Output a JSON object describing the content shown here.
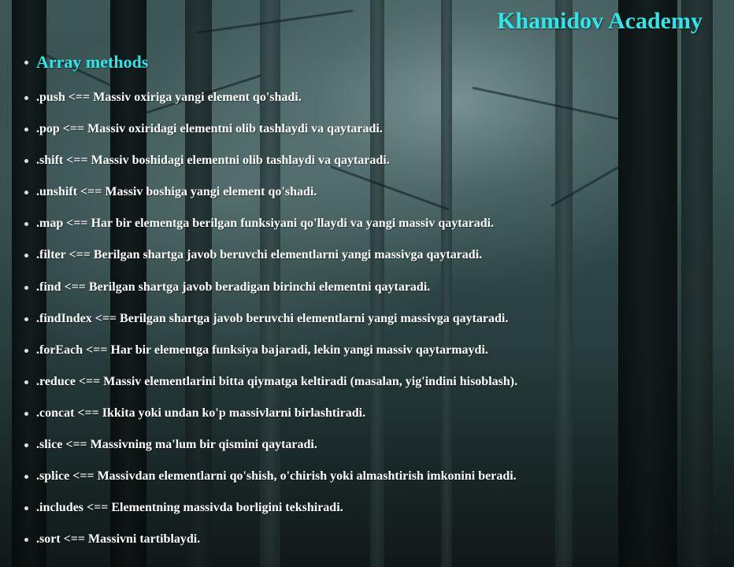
{
  "brand": "Khamidov Academy",
  "section_title": "Array methods",
  "methods": [
    ".push <== Massiv oxiriga yangi element qo'shadi.",
    ".pop <== Massiv oxiridagi elementni olib tashlaydi va qaytaradi.",
    ".shift <== Massiv boshidagi elementni olib tashlaydi va qaytaradi.",
    ".unshift <== Massiv boshiga yangi element qo'shadi.",
    ".map <== Har bir elementga berilgan funksiyani qo'llaydi va yangi massiv qaytaradi.",
    ".filter <== Berilgan shartga javob beruvchi elementlarni yangi massivga qaytaradi.",
    ".find <== Berilgan shartga javob beradigan birinchi elementni qaytaradi.",
    ".findIndex <== Berilgan shartga javob beruvchi elementlarni yangi massivga qaytaradi.",
    ".forEach <== Har bir elementga funksiya bajaradi, lekin yangi massiv qaytarmaydi.",
    ".reduce <== Massiv elementlarini bitta qiymatga keltiradi (masalan, yig'indini hisoblash).",
    ".concat <== Ikkita yoki undan ko'p massivlarni birlashtiradi.",
    ".slice <== Massivning ma'lum bir qismini qaytaradi.",
    ".splice <== Massivdan elementlarni qo'shish, o'chirish yoki almashtirish imkonini beradi.",
    ".includes <== Elementning massivda borligini tekshiradi.",
    ".sort <== Massivni tartiblaydi."
  ],
  "colors": {
    "accent": "#2fe6ea",
    "text": "#ffffff"
  }
}
